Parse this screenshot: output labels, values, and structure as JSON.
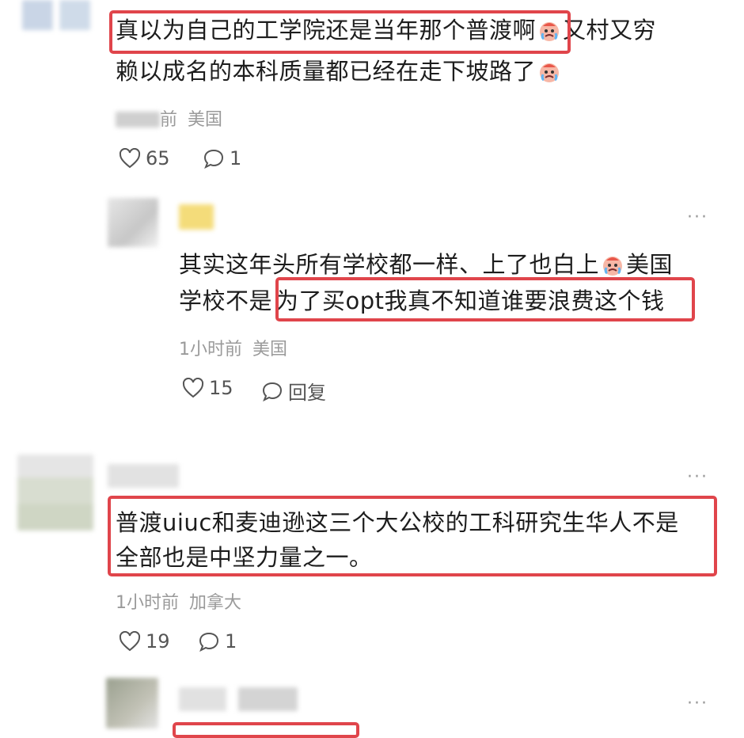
{
  "comments": [
    {
      "line1_part1": "真以为自己的工学院还是当年那个普渡啊",
      "line1_part2": "又村又穷",
      "line2": "赖以成名的本科质量都已经在走下坡路了",
      "meta_time": "前",
      "meta_region": "美国",
      "likes": "65",
      "replies": "1"
    },
    {
      "line1_part1": "其实这年头所有学校都一样、上了也白上",
      "line1_part2": "美国",
      "line2_part1": "学校不是",
      "line2_part2": "为了买opt我真不知道谁要浪费这个钱",
      "meta_time": "1小时前",
      "meta_region": "美国",
      "likes": "15",
      "reply_label": "回复"
    },
    {
      "line1": "普渡uiuc和麦迪逊这三个大公校的工科研究生华人不是",
      "line2": "全部也是中坚力量之一。",
      "meta_time": "1小时前",
      "meta_region": "加拿大",
      "likes": "19",
      "replies": "1"
    }
  ],
  "more_label": "···",
  "colors": {
    "highlight": "#e0454b",
    "meta": "#9a9a9a"
  },
  "icons": [
    "heart-icon",
    "comment-icon",
    "crying-emoji-icon",
    "more-icon"
  ]
}
